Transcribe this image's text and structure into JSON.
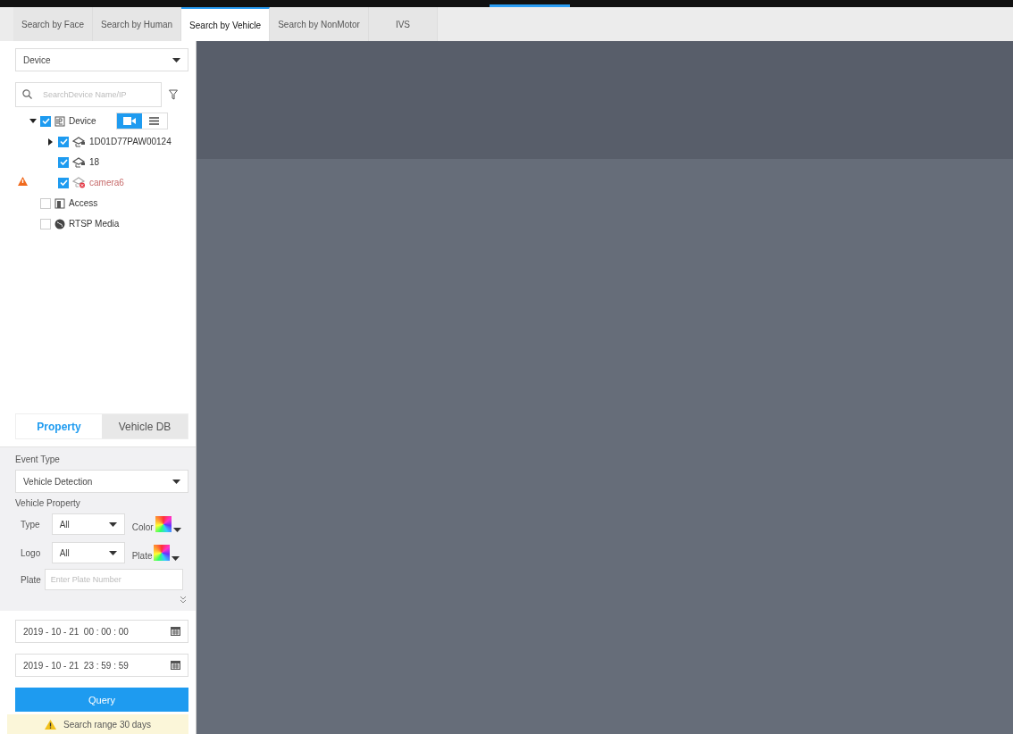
{
  "tabs": [
    {
      "label": "Search by Face",
      "selected": false
    },
    {
      "label": "Search by Human",
      "selected": false
    },
    {
      "label": "Search by Vehicle",
      "selected": true
    },
    {
      "label": "Search by NonMotor",
      "selected": false
    },
    {
      "label": "IVS",
      "selected": false
    }
  ],
  "source_dropdown": {
    "value": "Device"
  },
  "search": {
    "placeholder": "SearchDevice Name/IP"
  },
  "view_toggle": [
    {
      "kind": "camera",
      "selected": true
    },
    {
      "kind": "list",
      "selected": false
    }
  ],
  "tree": [
    {
      "label": "Device",
      "kind": "device",
      "checked": true,
      "expanded": true,
      "warning": false,
      "children": [
        {
          "label": "1D01D77PAW00124",
          "kind": "camera",
          "checked": true,
          "expanded": false,
          "warning": false
        },
        {
          "label": "18",
          "kind": "camera",
          "checked": true,
          "warning": false
        },
        {
          "label": "camera6",
          "kind": "camera_offline",
          "checked": true,
          "warning": true
        }
      ]
    },
    {
      "label": "Access",
      "kind": "access",
      "checked": false,
      "warning": false
    },
    {
      "label": "RTSP Media",
      "kind": "rtsp",
      "checked": false,
      "warning": false
    }
  ],
  "sub_tabs": [
    {
      "label": "Property",
      "selected": true
    },
    {
      "label": "Vehicle DB",
      "selected": false
    }
  ],
  "event_type": {
    "label": "Event Type",
    "value": "Vehicle Detection"
  },
  "vehicle_property": {
    "label": "Vehicle Property",
    "type": {
      "label": "Type",
      "value": "All"
    },
    "color": {
      "label": "Color"
    },
    "logo": {
      "label": "Logo",
      "value": "All"
    },
    "plate_color": {
      "label": "Plate"
    },
    "plate": {
      "label": "Plate",
      "placeholder": "Enter Plate Number"
    }
  },
  "start_time": "2019 - 10 - 21  00 : 00 : 00",
  "end_time": "2019 - 10 - 21  23 : 59 : 59",
  "query_button": "Query",
  "notice": "Search range 30 days"
}
